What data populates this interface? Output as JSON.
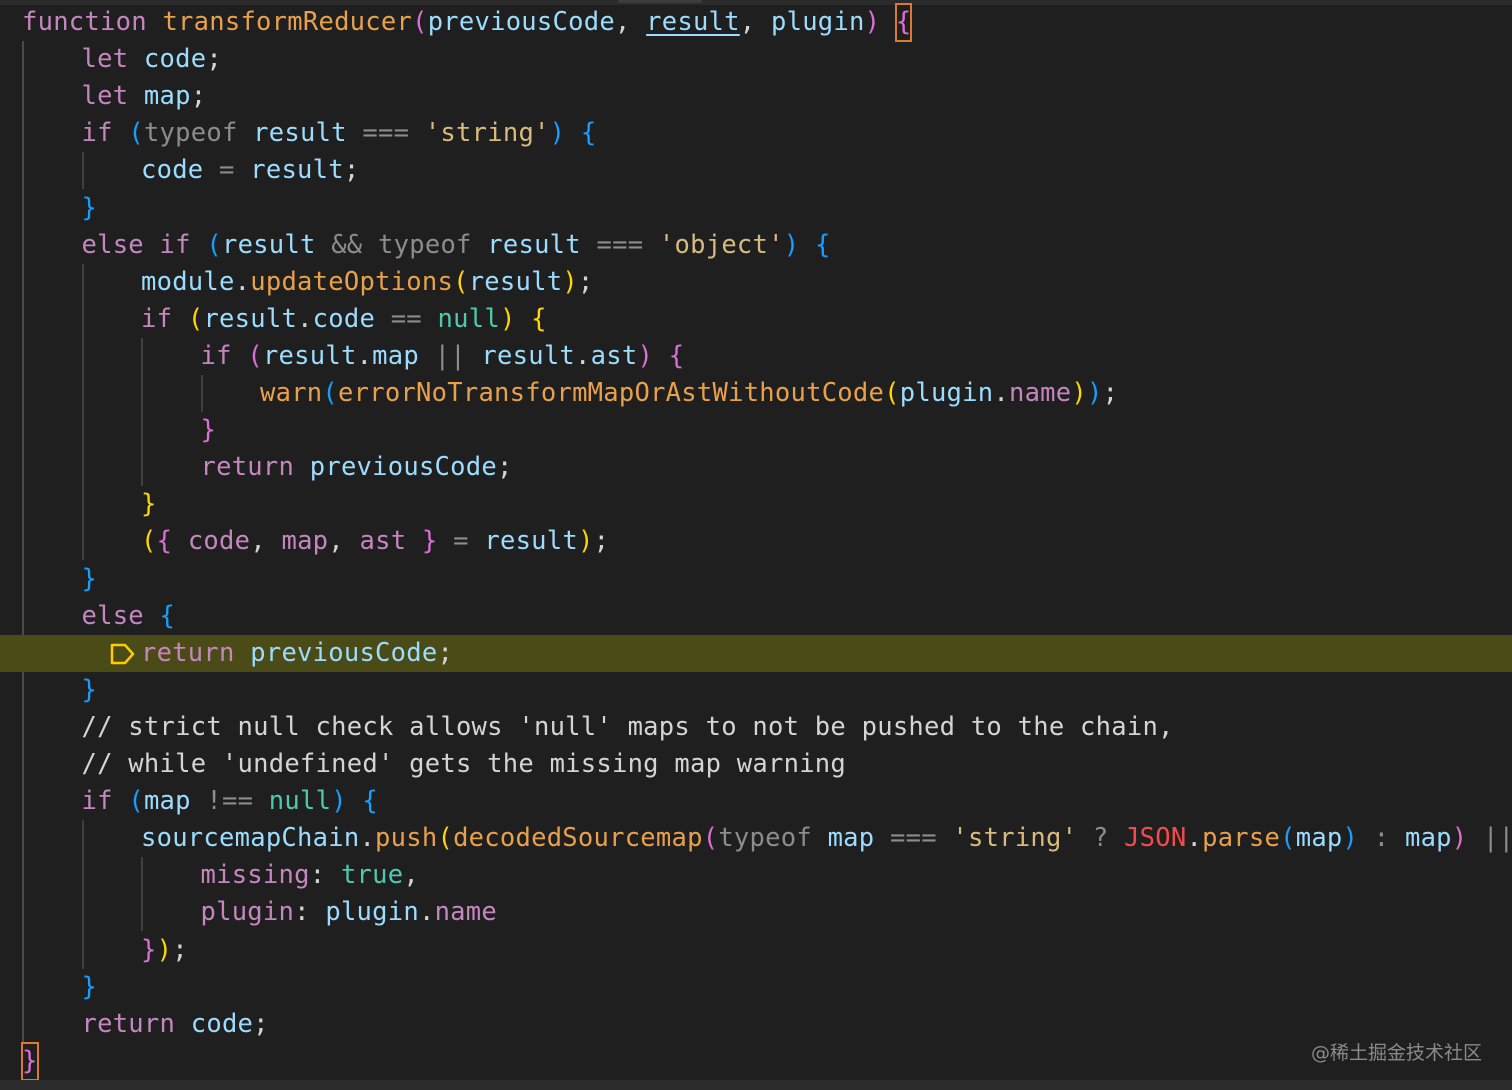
{
  "colors": {
    "keyword": "#c586c0",
    "function_name": "#e8a14a",
    "identifier": "#9cdcfe",
    "string": "#d7ba7d",
    "punctuation": "#d4d4d4",
    "bracket1": "#ffd700",
    "bracket2": "#da70d6",
    "bracket3": "#179fff",
    "comment": "#d4d4d4",
    "constant": "#4ec9b0",
    "property": "#c586c0",
    "json_global": "#f14c4c",
    "current_line_bg": "#4b4b18",
    "breakpoint": "#ffcc00"
  },
  "code_lines": [
    {
      "indent": 0,
      "tokens": [
        [
          "function",
          "#c586c0"
        ],
        [
          " ",
          ""
        ],
        [
          "transformReducer",
          "#e8a14a"
        ],
        [
          "(",
          "#da70d6"
        ],
        [
          "previousCode",
          "#9cdcfe"
        ],
        [
          ", ",
          "#d4d4d4"
        ],
        [
          "result",
          "#9cdcfe",
          "link"
        ],
        [
          ", ",
          "#d4d4d4"
        ],
        [
          "plugin",
          "#9cdcfe"
        ],
        [
          ")",
          "#da70d6"
        ],
        [
          " ",
          ""
        ],
        [
          "{",
          "#da70d6",
          "cursor"
        ]
      ]
    },
    {
      "indent": 1,
      "tokens": [
        [
          "let",
          "#c586c0"
        ],
        [
          " ",
          ""
        ],
        [
          "code",
          "#9cdcfe"
        ],
        [
          ";",
          "#d4d4d4"
        ]
      ]
    },
    {
      "indent": 1,
      "tokens": [
        [
          "let",
          "#c586c0"
        ],
        [
          " ",
          ""
        ],
        [
          "map",
          "#9cdcfe"
        ],
        [
          ";",
          "#d4d4d4"
        ]
      ]
    },
    {
      "indent": 1,
      "tokens": [
        [
          "if",
          "#c586c0"
        ],
        [
          " ",
          ""
        ],
        [
          "(",
          "#179fff"
        ],
        [
          "typeof",
          "#8c8c8c"
        ],
        [
          " ",
          ""
        ],
        [
          "result",
          "#9cdcfe"
        ],
        [
          " ",
          ""
        ],
        [
          "===",
          "#8c8c8c"
        ],
        [
          " ",
          ""
        ],
        [
          "'string'",
          "#d7ba7d"
        ],
        [
          ")",
          "#179fff"
        ],
        [
          " ",
          ""
        ],
        [
          "{",
          "#179fff"
        ]
      ]
    },
    {
      "indent": 2,
      "tokens": [
        [
          "code",
          "#9cdcfe"
        ],
        [
          " ",
          ""
        ],
        [
          "=",
          "#8c8c8c"
        ],
        [
          " ",
          ""
        ],
        [
          "result",
          "#9cdcfe"
        ],
        [
          ";",
          "#d4d4d4"
        ]
      ]
    },
    {
      "indent": 1,
      "tokens": [
        [
          "}",
          "#179fff"
        ]
      ]
    },
    {
      "indent": 1,
      "tokens": [
        [
          "else",
          "#c586c0"
        ],
        [
          " ",
          ""
        ],
        [
          "if",
          "#c586c0"
        ],
        [
          " ",
          ""
        ],
        [
          "(",
          "#179fff"
        ],
        [
          "result",
          "#9cdcfe"
        ],
        [
          " ",
          ""
        ],
        [
          "&&",
          "#8c8c8c"
        ],
        [
          " ",
          ""
        ],
        [
          "typeof",
          "#8c8c8c"
        ],
        [
          " ",
          ""
        ],
        [
          "result",
          "#9cdcfe"
        ],
        [
          " ",
          ""
        ],
        [
          "===",
          "#8c8c8c"
        ],
        [
          " ",
          ""
        ],
        [
          "'object'",
          "#d7ba7d"
        ],
        [
          ")",
          "#179fff"
        ],
        [
          " ",
          ""
        ],
        [
          "{",
          "#179fff"
        ]
      ]
    },
    {
      "indent": 2,
      "tokens": [
        [
          "module",
          "#9cdcfe"
        ],
        [
          ".",
          "#d4d4d4"
        ],
        [
          "updateOptions",
          "#e8a14a"
        ],
        [
          "(",
          "#ffd700"
        ],
        [
          "result",
          "#9cdcfe"
        ],
        [
          ")",
          "#ffd700"
        ],
        [
          ";",
          "#d4d4d4"
        ]
      ]
    },
    {
      "indent": 2,
      "tokens": [
        [
          "if",
          "#c586c0"
        ],
        [
          " ",
          ""
        ],
        [
          "(",
          "#ffd700"
        ],
        [
          "result",
          "#9cdcfe"
        ],
        [
          ".",
          "#d4d4d4"
        ],
        [
          "code",
          "#9cdcfe"
        ],
        [
          " ",
          ""
        ],
        [
          "==",
          "#8c8c8c"
        ],
        [
          " ",
          ""
        ],
        [
          "null",
          "#4ec9b0"
        ],
        [
          ")",
          "#ffd700"
        ],
        [
          " ",
          ""
        ],
        [
          "{",
          "#ffd700"
        ]
      ]
    },
    {
      "indent": 3,
      "tokens": [
        [
          "if",
          "#c586c0"
        ],
        [
          " ",
          ""
        ],
        [
          "(",
          "#da70d6"
        ],
        [
          "result",
          "#9cdcfe"
        ],
        [
          ".",
          "#d4d4d4"
        ],
        [
          "map",
          "#9cdcfe"
        ],
        [
          " ",
          ""
        ],
        [
          "||",
          "#8c8c8c"
        ],
        [
          " ",
          ""
        ],
        [
          "result",
          "#9cdcfe"
        ],
        [
          ".",
          "#d4d4d4"
        ],
        [
          "ast",
          "#9cdcfe"
        ],
        [
          ")",
          "#da70d6"
        ],
        [
          " ",
          ""
        ],
        [
          "{",
          "#da70d6"
        ]
      ]
    },
    {
      "indent": 4,
      "tokens": [
        [
          "warn",
          "#e8a14a"
        ],
        [
          "(",
          "#179fff"
        ],
        [
          "errorNoTransformMapOrAstWithoutCode",
          "#e8a14a"
        ],
        [
          "(",
          "#ffd700"
        ],
        [
          "plugin",
          "#9cdcfe"
        ],
        [
          ".",
          "#d4d4d4"
        ],
        [
          "name",
          "#c586c0"
        ],
        [
          ")",
          "#ffd700"
        ],
        [
          ")",
          "#179fff"
        ],
        [
          ";",
          "#d4d4d4"
        ]
      ]
    },
    {
      "indent": 3,
      "tokens": [
        [
          "}",
          "#da70d6"
        ]
      ]
    },
    {
      "indent": 3,
      "tokens": [
        [
          "return",
          "#c586c0"
        ],
        [
          " ",
          ""
        ],
        [
          "previousCode",
          "#9cdcfe"
        ],
        [
          ";",
          "#d4d4d4"
        ]
      ]
    },
    {
      "indent": 2,
      "tokens": [
        [
          "}",
          "#ffd700"
        ]
      ]
    },
    {
      "indent": 2,
      "tokens": [
        [
          "(",
          "#ffd700"
        ],
        [
          "{",
          "#da70d6"
        ],
        [
          " ",
          ""
        ],
        [
          "code",
          "#c586c0"
        ],
        [
          ", ",
          "#d4d4d4"
        ],
        [
          "map",
          "#c586c0"
        ],
        [
          ", ",
          "#d4d4d4"
        ],
        [
          "ast",
          "#c586c0"
        ],
        [
          " ",
          ""
        ],
        [
          "}",
          "#da70d6"
        ],
        [
          " ",
          ""
        ],
        [
          "=",
          "#8c8c8c"
        ],
        [
          " ",
          ""
        ],
        [
          "result",
          "#9cdcfe"
        ],
        [
          ")",
          "#ffd700"
        ],
        [
          ";",
          "#d4d4d4"
        ]
      ]
    },
    {
      "indent": 1,
      "tokens": [
        [
          "}",
          "#179fff"
        ]
      ]
    },
    {
      "indent": 1,
      "tokens": [
        [
          "else",
          "#c586c0"
        ],
        [
          " ",
          ""
        ],
        [
          "{",
          "#179fff"
        ]
      ]
    },
    {
      "indent": 2,
      "current": true,
      "breakpoint": true,
      "tokens": [
        [
          "return",
          "#c586c0"
        ],
        [
          " ",
          ""
        ],
        [
          "previousCode",
          "#9cdcfe"
        ],
        [
          ";",
          "#d4d4d4"
        ]
      ]
    },
    {
      "indent": 1,
      "tokens": [
        [
          "}",
          "#179fff"
        ]
      ]
    },
    {
      "indent": 1,
      "tokens": [
        [
          "// strict null check allows 'null' maps to not be pushed to the chain,",
          "#d4d4d4"
        ]
      ]
    },
    {
      "indent": 1,
      "tokens": [
        [
          "// while 'undefined' gets the missing map warning",
          "#d4d4d4"
        ]
      ]
    },
    {
      "indent": 1,
      "tokens": [
        [
          "if",
          "#c586c0"
        ],
        [
          " ",
          ""
        ],
        [
          "(",
          "#179fff"
        ],
        [
          "map",
          "#9cdcfe"
        ],
        [
          " ",
          ""
        ],
        [
          "!==",
          "#8c8c8c"
        ],
        [
          " ",
          ""
        ],
        [
          "null",
          "#4ec9b0"
        ],
        [
          ")",
          "#179fff"
        ],
        [
          " ",
          ""
        ],
        [
          "{",
          "#179fff"
        ]
      ]
    },
    {
      "indent": 2,
      "tokens": [
        [
          "sourcemapChain",
          "#9cdcfe"
        ],
        [
          ".",
          "#d4d4d4"
        ],
        [
          "push",
          "#e8a14a"
        ],
        [
          "(",
          "#ffd700"
        ],
        [
          "decodedSourcemap",
          "#e8a14a"
        ],
        [
          "(",
          "#da70d6"
        ],
        [
          "typeof",
          "#8c8c8c"
        ],
        [
          " ",
          ""
        ],
        [
          "map",
          "#9cdcfe"
        ],
        [
          " ",
          ""
        ],
        [
          "===",
          "#8c8c8c"
        ],
        [
          " ",
          ""
        ],
        [
          "'string'",
          "#d7ba7d"
        ],
        [
          " ",
          ""
        ],
        [
          "?",
          "#8c8c8c"
        ],
        [
          " ",
          ""
        ],
        [
          "JSON",
          "#f14c4c"
        ],
        [
          ".",
          "#d4d4d4"
        ],
        [
          "parse",
          "#e8a14a"
        ],
        [
          "(",
          "#179fff"
        ],
        [
          "map",
          "#9cdcfe"
        ],
        [
          ")",
          "#179fff"
        ],
        [
          " ",
          ""
        ],
        [
          ":",
          "#8c8c8c"
        ],
        [
          " ",
          ""
        ],
        [
          "map",
          "#9cdcfe"
        ],
        [
          ")",
          "#da70d6"
        ],
        [
          " ",
          ""
        ],
        [
          "||",
          "#8c8c8c"
        ],
        [
          " ",
          ""
        ],
        [
          "{",
          "#da70d6"
        ]
      ]
    },
    {
      "indent": 3,
      "tokens": [
        [
          "missing",
          "#c586c0"
        ],
        [
          ": ",
          "#d4d4d4"
        ],
        [
          "true",
          "#4ec9b0"
        ],
        [
          ",",
          "#d4d4d4"
        ]
      ]
    },
    {
      "indent": 3,
      "tokens": [
        [
          "plugin",
          "#c586c0"
        ],
        [
          ": ",
          "#d4d4d4"
        ],
        [
          "plugin",
          "#9cdcfe"
        ],
        [
          ".",
          "#d4d4d4"
        ],
        [
          "name",
          "#c586c0"
        ]
      ]
    },
    {
      "indent": 2,
      "tokens": [
        [
          "}",
          "#da70d6"
        ],
        [
          ")",
          "#ffd700"
        ],
        [
          ";",
          "#d4d4d4"
        ]
      ]
    },
    {
      "indent": 1,
      "tokens": [
        [
          "}",
          "#179fff"
        ]
      ]
    },
    {
      "indent": 1,
      "tokens": [
        [
          "return",
          "#c586c0"
        ],
        [
          " ",
          ""
        ],
        [
          "code",
          "#9cdcfe"
        ],
        [
          ";",
          "#d4d4d4"
        ]
      ]
    },
    {
      "indent": 0,
      "tokens": [
        [
          "}",
          "#da70d6",
          "cursor"
        ]
      ]
    }
  ],
  "watermark": "@稀土掘金技术社区"
}
